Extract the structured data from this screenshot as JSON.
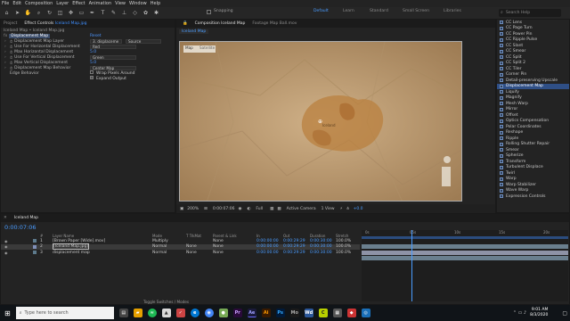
{
  "menubar": [
    "File",
    "Edit",
    "Composition",
    "Layer",
    "Effect",
    "Animation",
    "View",
    "Window",
    "Help"
  ],
  "toolbar": {
    "snapping_label": "Snapping",
    "workspaces": [
      "Default",
      "Learn",
      "Standard",
      "Small Screen",
      "Libraries"
    ],
    "search_placeholder": "Search Help"
  },
  "project_panel": {
    "tabs": [
      "Project",
      "Effect Controls",
      "Iceland Map.jpg"
    ],
    "breadcrumb": "Iceland Map • Iceland Map.jpg",
    "effect_name": "Displacement Map",
    "reset_label": "Reset",
    "rows": [
      {
        "label": "Displacement Map Layer",
        "value": "3. displaceme",
        "value2": "Source",
        "type": "dropdown"
      },
      {
        "label": "Use For Horizontal Displacement",
        "value": "Red",
        "type": "dropdown"
      },
      {
        "label": "Max Horizontal Displacement",
        "value": "5.0",
        "type": "number"
      },
      {
        "label": "Use For Vertical Displacement",
        "value": "Green",
        "type": "dropdown"
      },
      {
        "label": "Max Vertical Displacement",
        "value": "5.0",
        "type": "number"
      },
      {
        "label": "Displacement Map Behavior",
        "value": "Center Map",
        "type": "dropdown"
      },
      {
        "label": "Edge Behavior",
        "value": "Wrap Pixels Around",
        "type": "check"
      },
      {
        "label": "",
        "value": "Expand Output",
        "type": "check_on"
      }
    ]
  },
  "comp_panel": {
    "tabs": [
      "Composition Iceland Map",
      "Footage Map Ball.mov"
    ],
    "comp_name_tab": "Iceland Map",
    "map_label": "Iceland",
    "top_buttons": [
      "Map",
      "Satellite"
    ],
    "footer": {
      "zoom": "200%",
      "timecode": "0:00:07:06",
      "resolution": "Full",
      "camera": "Active Camera",
      "view": "1 View",
      "exposure": "+0.0"
    }
  },
  "effects_list": [
    "CC Lens",
    "CC Page Turn",
    "CC Power Pin",
    "CC Ripple Pulse",
    "CC Slant",
    "CC Smear",
    "CC Split",
    "CC Split 2",
    "CC Tiler",
    "Corner Pin",
    "Detail-preserving Upscale",
    "Displacement Map",
    "Liquify",
    "Magnify",
    "Mesh Warp",
    "Mirror",
    "Offset",
    "Optics Compensation",
    "Polar Coordinates",
    "Reshape",
    "Ripple",
    "Rolling Shutter Repair",
    "Smear",
    "Spherize",
    "Transform",
    "Turbulent Displace",
    "Twirl",
    "Warp",
    "Warp Stabilizer",
    "Wave Warp",
    "Expression Controls"
  ],
  "effects_selected_index": 11,
  "timeline": {
    "tab": "Iceland Map",
    "timecode": "0:00:07:06",
    "columns": [
      "#",
      "Layer Name",
      "Mode",
      "T TrkMat",
      "Parent & Link",
      "In",
      "Out",
      "Duration",
      "Stretch"
    ],
    "layers": [
      {
        "num": "1",
        "name": "[Brown Paper [Wide].mov]",
        "mode": "Multiply",
        "trkmat": "",
        "parent": "None",
        "in": "0:00:00:00",
        "out": "0:00:29:29",
        "duration": "0:00:30:00",
        "stretch": "100.0%"
      },
      {
        "num": "2",
        "name": "[Iceland Map.jpg]",
        "mode": "Normal",
        "trkmat": "None",
        "parent": "None",
        "in": "0:00:00:00",
        "out": "0:00:29:29",
        "duration": "0:00:30:00",
        "stretch": "100.0%"
      },
      {
        "num": "3",
        "name": "displacement map",
        "mode": "Normal",
        "trkmat": "None",
        "parent": "None",
        "in": "0:00:00:00",
        "out": "0:00:29:29",
        "duration": "0:00:30:00",
        "stretch": "100.0%"
      }
    ],
    "ruler": [
      "0s",
      "05s",
      "10s",
      "15s",
      "20s"
    ],
    "footer_label": "Toggle Switches / Modes",
    "playhead_fraction": 0.24
  },
  "taskbar": {
    "search_placeholder": "Type here to search",
    "time": "9:01 AM",
    "date": "8/3/2020",
    "apps": [
      "Pr",
      "Ae",
      "Ai",
      "Ps",
      "Mo",
      "Wd"
    ]
  },
  "colors": {
    "accent": "#3f8fff",
    "selection": "#2f4f86",
    "bg": "#232323"
  }
}
